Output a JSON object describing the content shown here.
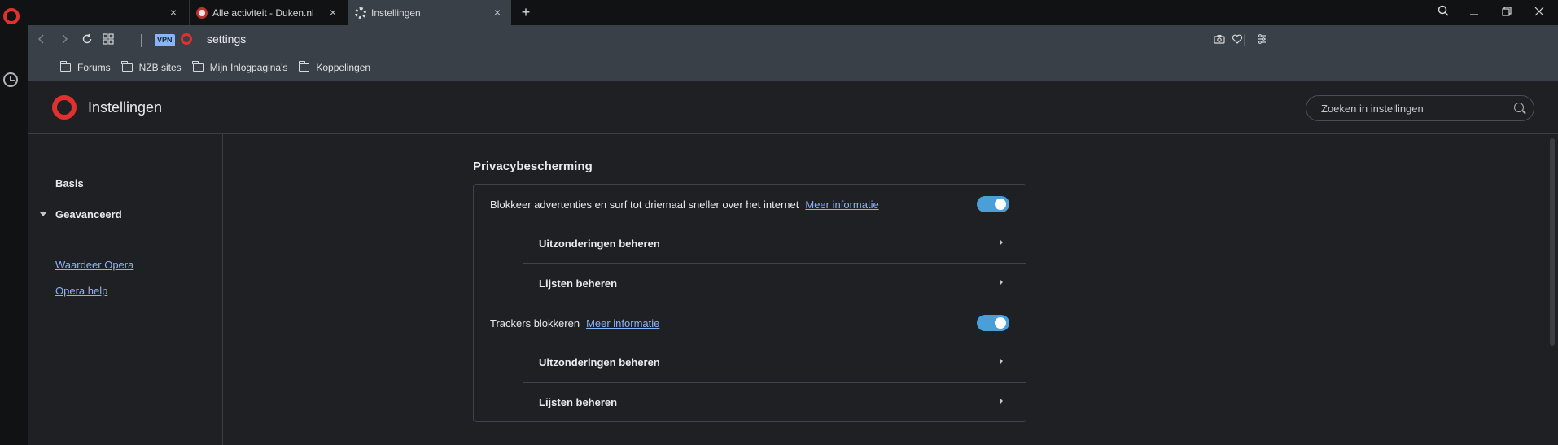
{
  "tabs": [
    {
      "title": "",
      "active": false
    },
    {
      "title": "Alle activiteit - Duken.nl",
      "active": false
    },
    {
      "title": "Instellingen",
      "active": true
    }
  ],
  "tab_close_glyph": "×",
  "new_tab_glyph": "+",
  "address": {
    "vpn_label": "VPN",
    "url": "settings"
  },
  "bookmarks": [
    "Forums",
    "NZB sites",
    "Mijn Inlogpagina's",
    "Koppelingen"
  ],
  "header": {
    "title": "Instellingen",
    "search_placeholder": "Zoeken in instellingen"
  },
  "leftnav": {
    "basis": "Basis",
    "advanced": "Geavanceerd",
    "rate": "Waardeer Opera",
    "help": "Opera help"
  },
  "section": {
    "title": "Privacybescherming",
    "ads": {
      "label": "Blokkeer advertenties en surf tot driemaal sneller over het internet",
      "link": "Meer informatie",
      "enabled": true,
      "sub_exceptions": "Uitzonderingen beheren",
      "sub_lists": "Lijsten beheren"
    },
    "trackers": {
      "label": "Trackers blokkeren",
      "link": "Meer informatie",
      "enabled": true,
      "sub_exceptions": "Uitzonderingen beheren",
      "sub_lists": "Lijsten beheren"
    }
  },
  "colors": {
    "accent_red": "#e0312f",
    "toggle_on": "#4a9fd8",
    "link": "#8ab4f8",
    "background": "#1e2024",
    "toolbar": "#3a4047"
  }
}
